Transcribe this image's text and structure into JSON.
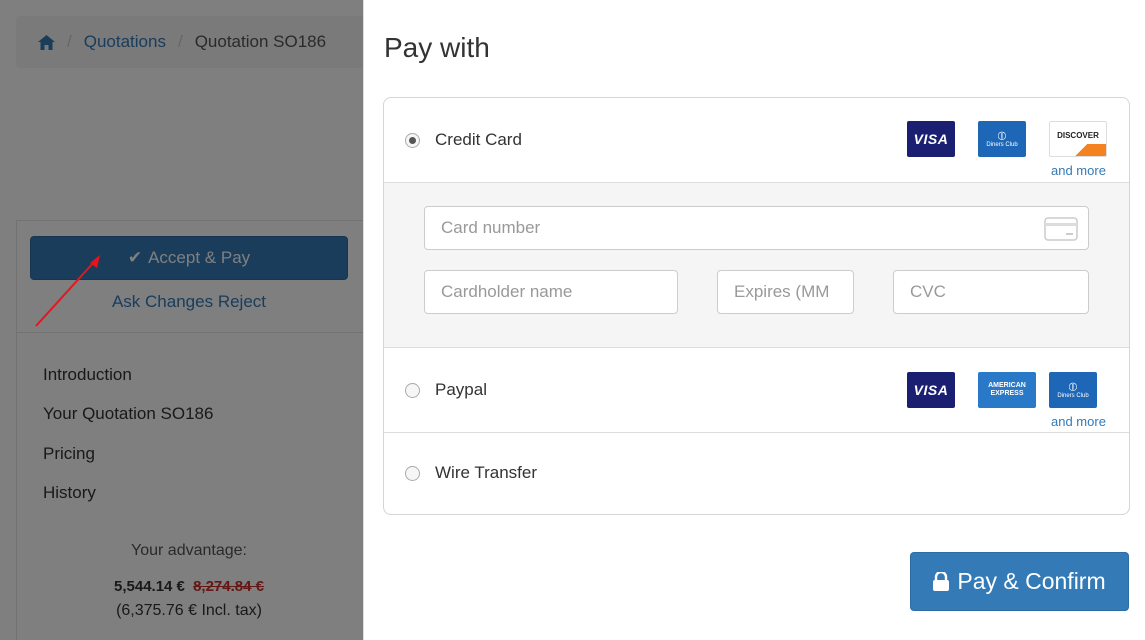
{
  "breadcrumb": {
    "home_icon": "home-icon",
    "items": [
      "Quotations",
      "Quotation SO186"
    ]
  },
  "sidebar": {
    "accept_label": "Accept & Pay",
    "ask_changes_label": "Ask Changes",
    "reject_label": "Reject",
    "nav": [
      "Introduction",
      "Your Quotation SO186",
      "Pricing",
      "History"
    ],
    "advantage_title": "Your advantage:",
    "price_new": "5,544.14 €",
    "price_old": "8,274.84 €",
    "price_incl_tax": "(6,375.76 € Incl. tax)"
  },
  "modal": {
    "title": "Pay with",
    "methods": [
      {
        "label": "Credit Card",
        "selected": true,
        "logos": [
          "VISA",
          "Diners Club",
          "DISCOVER"
        ],
        "more": "and more"
      },
      {
        "label": "Paypal",
        "selected": false,
        "logos": [
          "VISA",
          "AMERICAN EXPRESS",
          "Diners Club"
        ],
        "more": "and more"
      },
      {
        "label": "Wire Transfer",
        "selected": false
      }
    ],
    "card_form": {
      "card_number_placeholder": "Card number",
      "cardholder_placeholder": "Cardholder name",
      "expires_placeholder": "Expires (MM",
      "cvc_placeholder": "CVC"
    },
    "pay_button": "Pay & Confirm"
  },
  "colors": {
    "primary": "#337ab7",
    "visa_blue": "#1a1f71",
    "diners_blue": "#1e67b6",
    "discover_orange": "#f58220",
    "overlay": "#000000"
  }
}
